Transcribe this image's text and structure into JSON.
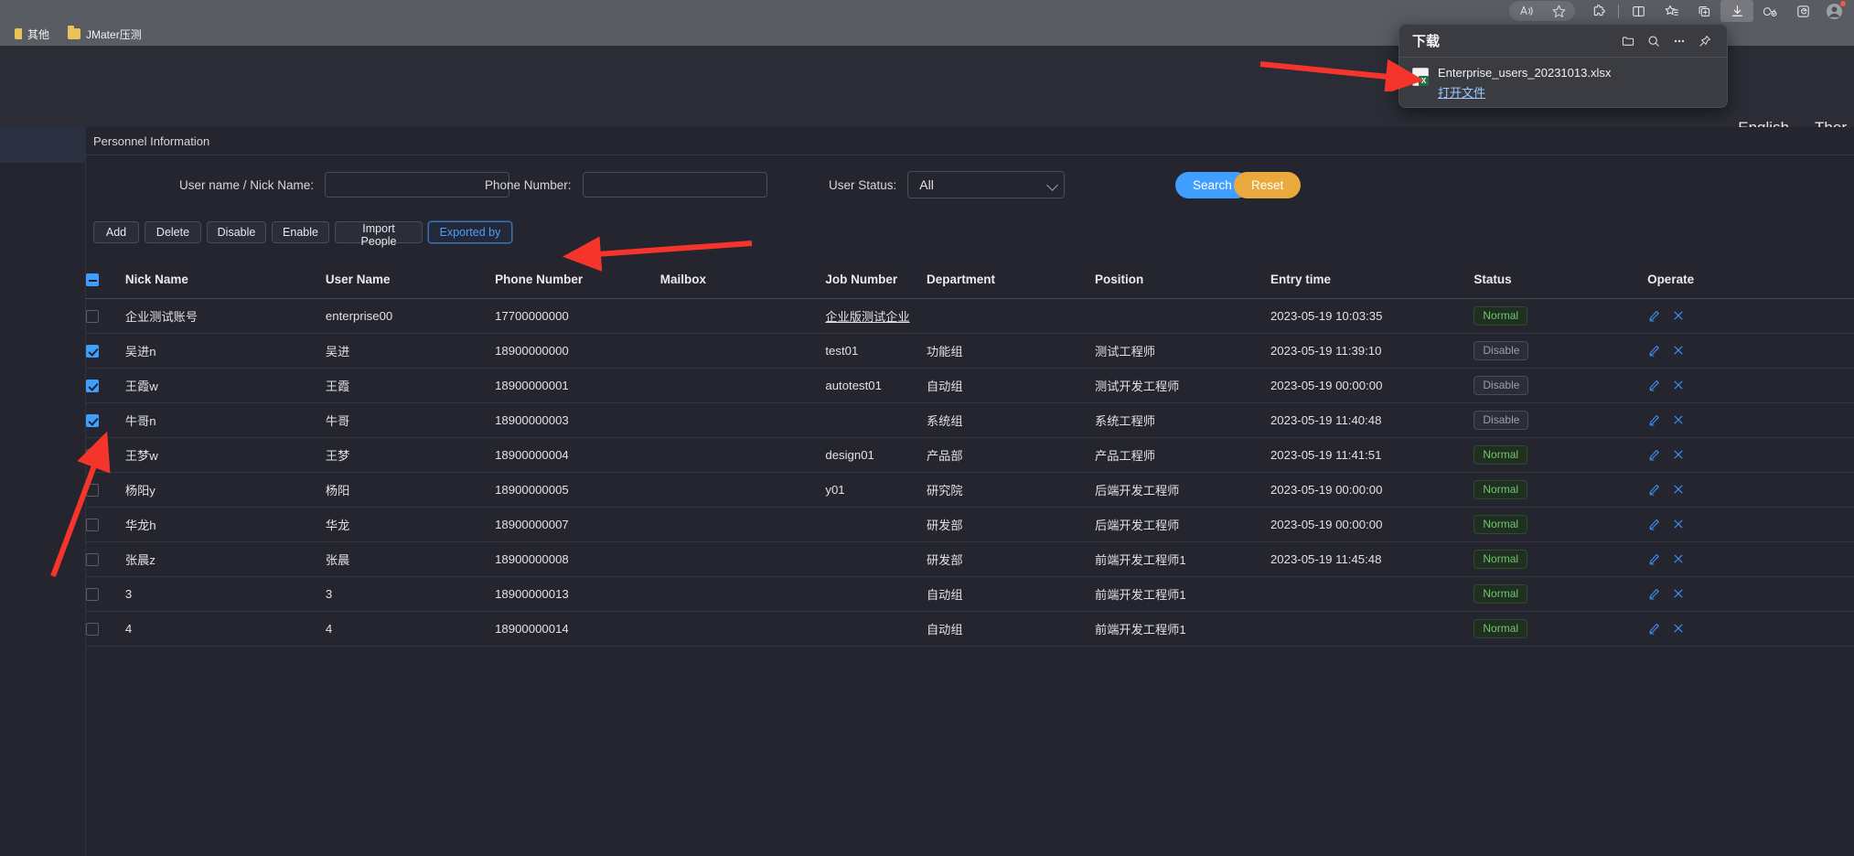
{
  "browser": {
    "bookmarks": [
      {
        "label": "其他",
        "icon": "folder-icon"
      },
      {
        "label": "JMater压测",
        "icon": "folder-icon"
      }
    ],
    "toolbar_icons": [
      "read-aloud-icon",
      "favorites-star-icon",
      "extensions-icon",
      "split-screen-icon",
      "collections-icon",
      "browser-essentials-icon",
      "downloads-icon",
      "copilot-icon",
      "ie-mode-icon",
      "profile-avatar-icon"
    ]
  },
  "downloads": {
    "title": "下载",
    "header_icons": [
      "open-folder-icon",
      "search-icon",
      "more-options-icon",
      "pin-icon"
    ],
    "file_name": "Enterprise_users_20231013.xlsx",
    "open_file_label": "打开文件",
    "file_type_icon": "excel-file-icon"
  },
  "app_header": {
    "language": "English",
    "theme": "Ther"
  },
  "panel": {
    "title": "Personnel Information"
  },
  "search_form": {
    "username_label": "User name / Nick Name:",
    "username_value": "",
    "username_placeholder": "",
    "phone_label": "Phone Number:",
    "phone_value": "",
    "phone_placeholder": "",
    "status_label": "User Status:",
    "status_value": "All",
    "status_options": [
      "All"
    ],
    "search_button": "Search",
    "reset_button": "Reset",
    "search_color": "#409eff",
    "reset_color": "#e9a93c"
  },
  "actions": [
    {
      "label": "Add",
      "focused": false
    },
    {
      "label": "Delete",
      "focused": false
    },
    {
      "label": "Disable",
      "focused": false
    },
    {
      "label": "Enable",
      "focused": false
    },
    {
      "label": "Import People",
      "focused": false
    },
    {
      "label": "Exported by",
      "focused": true
    }
  ],
  "table": {
    "select_all_state": "indeterminate",
    "columns": [
      "Nick Name",
      "User Name",
      "Phone Number",
      "Mailbox",
      "Job Number",
      "Department",
      "Position",
      "Entry time",
      "Status",
      "Operate"
    ],
    "rows": [
      {
        "checked": false,
        "nick_name": "企业测试账号",
        "user_name": "enterprise00",
        "phone": "17700000000",
        "mailbox": "",
        "job_number": "企业版测试企业",
        "job_number_link": true,
        "department": "",
        "position": "",
        "entry_time": "2023-05-19 10:03:35",
        "status": "Normal",
        "status_kind": "normal"
      },
      {
        "checked": true,
        "nick_name": "吴进n",
        "user_name": "吴进",
        "phone": "18900000000",
        "mailbox": "",
        "job_number": "test01",
        "job_number_link": false,
        "department": "功能组",
        "position": "测试工程师",
        "entry_time": "2023-05-19 11:39:10",
        "status": "Disable",
        "status_kind": "disable"
      },
      {
        "checked": true,
        "nick_name": "王霞w",
        "user_name": "王霞",
        "phone": "18900000001",
        "mailbox": "",
        "job_number": "autotest01",
        "job_number_link": false,
        "department": "自动组",
        "position": "测试开发工程师",
        "entry_time": "2023-05-19 00:00:00",
        "status": "Disable",
        "status_kind": "disable"
      },
      {
        "checked": true,
        "nick_name": "牛哥n",
        "user_name": "牛哥",
        "phone": "18900000003",
        "mailbox": "",
        "job_number": "",
        "job_number_link": false,
        "department": "系统组",
        "position": "系统工程师",
        "entry_time": "2023-05-19 11:40:48",
        "status": "Disable",
        "status_kind": "disable"
      },
      {
        "checked": false,
        "nick_name": "王梦w",
        "user_name": "王梦",
        "phone": "18900000004",
        "mailbox": "",
        "job_number": "design01",
        "job_number_link": false,
        "department": "产品部",
        "position": "产品工程师",
        "entry_time": "2023-05-19 11:41:51",
        "status": "Normal",
        "status_kind": "normal"
      },
      {
        "checked": false,
        "nick_name": "杨阳y",
        "user_name": "杨阳",
        "phone": "18900000005",
        "mailbox": "",
        "job_number": "y01",
        "job_number_link": false,
        "department": "研究院",
        "position": "后端开发工程师",
        "entry_time": "2023-05-19 00:00:00",
        "status": "Normal",
        "status_kind": "normal"
      },
      {
        "checked": false,
        "nick_name": "华龙h",
        "user_name": "华龙",
        "phone": "18900000007",
        "mailbox": "",
        "job_number": "",
        "job_number_link": false,
        "department": "研发部",
        "position": "后端开发工程师",
        "entry_time": "2023-05-19 00:00:00",
        "status": "Normal",
        "status_kind": "normal"
      },
      {
        "checked": false,
        "nick_name": "张晨z",
        "user_name": "张晨",
        "phone": "18900000008",
        "mailbox": "",
        "job_number": "",
        "job_number_link": false,
        "department": "研发部",
        "position": "前端开发工程师1",
        "entry_time": "2023-05-19 11:45:48",
        "status": "Normal",
        "status_kind": "normal"
      },
      {
        "checked": false,
        "nick_name": "3",
        "user_name": "3",
        "phone": "18900000013",
        "mailbox": "",
        "job_number": "",
        "job_number_link": false,
        "department": "自动组",
        "position": "前端开发工程师1",
        "entry_time": "",
        "status": "Normal",
        "status_kind": "normal"
      },
      {
        "checked": false,
        "nick_name": "4",
        "user_name": "4",
        "phone": "18900000014",
        "mailbox": "",
        "job_number": "",
        "job_number_link": false,
        "department": "自动组",
        "position": "前端开发工程师1",
        "entry_time": "",
        "status": "Normal",
        "status_kind": "normal"
      }
    ],
    "operate_icons": [
      "edit-pencil-icon",
      "close-x-icon"
    ]
  },
  "annotations": {
    "arrow_color": "#f5352b",
    "arrows": [
      {
        "name": "arrow-to-downloaded-file",
        "points_to": "downloaded-file-entry"
      },
      {
        "name": "arrow-to-exported-by-button",
        "points_to": "exported-by-button"
      },
      {
        "name": "arrow-to-row-checkboxes",
        "points_to": "row-checkboxes"
      }
    ]
  }
}
